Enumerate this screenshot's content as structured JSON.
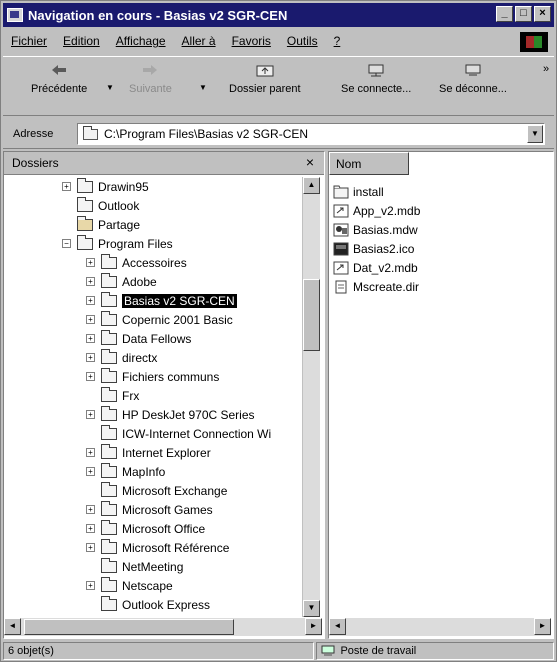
{
  "window": {
    "title": "Navigation en cours - Basias v2 SGR-CEN",
    "minimize": "_",
    "maximize": "□",
    "close": "×"
  },
  "menu": [
    "Fichier",
    "Edition",
    "Affichage",
    "Aller à",
    "Favoris",
    "Outils",
    "?"
  ],
  "toolbar": {
    "back": "Précédente",
    "forward": "Suivante",
    "up": "Dossier parent",
    "connect": "Se connecte...",
    "disconnect": "Se déconne...",
    "more": "»"
  },
  "address": {
    "label": "Adresse",
    "value": "C:\\Program Files\\Basias v2 SGR-CEN"
  },
  "folders_pane": {
    "title": "Dossiers",
    "close": "×",
    "tree": [
      {
        "label": "Drawin95",
        "indent": 1,
        "expand": "+",
        "icon": "folder-icon"
      },
      {
        "label": "Outlook",
        "indent": 1,
        "expand": "",
        "icon": "folder-icon"
      },
      {
        "label": "Partage",
        "indent": 1,
        "expand": "",
        "icon": "shared-folder-icon"
      },
      {
        "label": "Program Files",
        "indent": 1,
        "expand": "−",
        "icon": "open-folder-icon"
      },
      {
        "label": "Accessoires",
        "indent": 2,
        "expand": "+",
        "icon": "folder-icon"
      },
      {
        "label": "Adobe",
        "indent": 2,
        "expand": "+",
        "icon": "folder-icon"
      },
      {
        "label": "Basias v2 SGR-CEN",
        "indent": 2,
        "expand": "+",
        "icon": "open-folder-icon",
        "selected": true
      },
      {
        "label": "Copernic 2001 Basic",
        "indent": 2,
        "expand": "+",
        "icon": "folder-icon"
      },
      {
        "label": "Data Fellows",
        "indent": 2,
        "expand": "+",
        "icon": "folder-icon"
      },
      {
        "label": "directx",
        "indent": 2,
        "expand": "+",
        "icon": "folder-icon"
      },
      {
        "label": "Fichiers communs",
        "indent": 2,
        "expand": "+",
        "icon": "folder-icon"
      },
      {
        "label": "Frx",
        "indent": 2,
        "expand": "",
        "icon": "folder-icon"
      },
      {
        "label": "HP DeskJet 970C Series",
        "indent": 2,
        "expand": "+",
        "icon": "folder-icon"
      },
      {
        "label": "ICW-Internet Connection Wi",
        "indent": 2,
        "expand": "",
        "icon": "folder-icon"
      },
      {
        "label": "Internet Explorer",
        "indent": 2,
        "expand": "+",
        "icon": "folder-icon"
      },
      {
        "label": "MapInfo",
        "indent": 2,
        "expand": "+",
        "icon": "folder-icon"
      },
      {
        "label": "Microsoft Exchange",
        "indent": 2,
        "expand": "",
        "icon": "folder-icon"
      },
      {
        "label": "Microsoft Games",
        "indent": 2,
        "expand": "+",
        "icon": "folder-icon"
      },
      {
        "label": "Microsoft Office",
        "indent": 2,
        "expand": "+",
        "icon": "folder-icon"
      },
      {
        "label": "Microsoft Référence",
        "indent": 2,
        "expand": "+",
        "icon": "folder-icon"
      },
      {
        "label": "NetMeeting",
        "indent": 2,
        "expand": "",
        "icon": "folder-icon"
      },
      {
        "label": "Netscape",
        "indent": 2,
        "expand": "+",
        "icon": "folder-icon"
      },
      {
        "label": "Outlook Express",
        "indent": 2,
        "expand": "",
        "icon": "folder-icon"
      }
    ]
  },
  "files_pane": {
    "column": "Nom",
    "files": [
      {
        "label": "install",
        "icon": "folder-icon"
      },
      {
        "label": "App_v2.mdb",
        "icon": "shortcut-icon"
      },
      {
        "label": "Basias.mdw",
        "icon": "workgroup-file-icon"
      },
      {
        "label": "Basias2.ico",
        "icon": "ico-file-icon"
      },
      {
        "label": "Dat_v2.mdb",
        "icon": "shortcut-icon"
      },
      {
        "label": "Mscreate.dir",
        "icon": "file-icon"
      }
    ]
  },
  "status": {
    "objects": "6 objet(s)",
    "zone": "Poste de travail"
  },
  "colors": {
    "titlebar": "#1a1a6e",
    "face": "#c0c0c0",
    "selection": "#000000"
  }
}
